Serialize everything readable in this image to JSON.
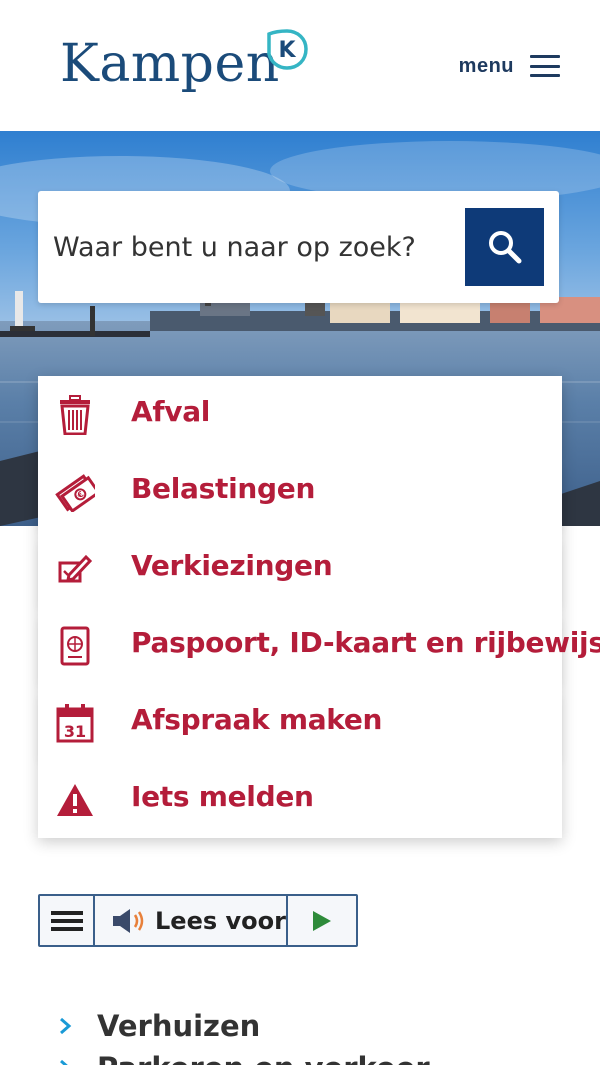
{
  "header": {
    "logo_text": "Kampen",
    "logo_badge": "K",
    "menu_label": "menu"
  },
  "search": {
    "placeholder": "Waar bent u naar op zoek?"
  },
  "quick_links": [
    {
      "label": "Afval",
      "icon": "trash-icon"
    },
    {
      "label": "Belastingen",
      "icon": "money-icon"
    },
    {
      "label": "Verkiezingen",
      "icon": "ballot-pen-icon"
    },
    {
      "label": "Paspoort, ID-kaart en rijbewijs",
      "icon": "passport-icon"
    },
    {
      "label": "Afspraak maken",
      "icon": "calendar-icon"
    },
    {
      "label": "Iets melden",
      "icon": "warning-icon"
    }
  ],
  "calendar_day": "31",
  "readspeaker": {
    "lees_voor_label": "Lees voor"
  },
  "links": [
    {
      "label": "Verhuizen"
    },
    {
      "label": "Parkeren en verkeer"
    }
  ],
  "colors": {
    "brand_blue": "#1b4b7a",
    "accent_red": "#b41d3a",
    "search_button": "#0e3a78",
    "link_chevron": "#1a9ad6"
  }
}
